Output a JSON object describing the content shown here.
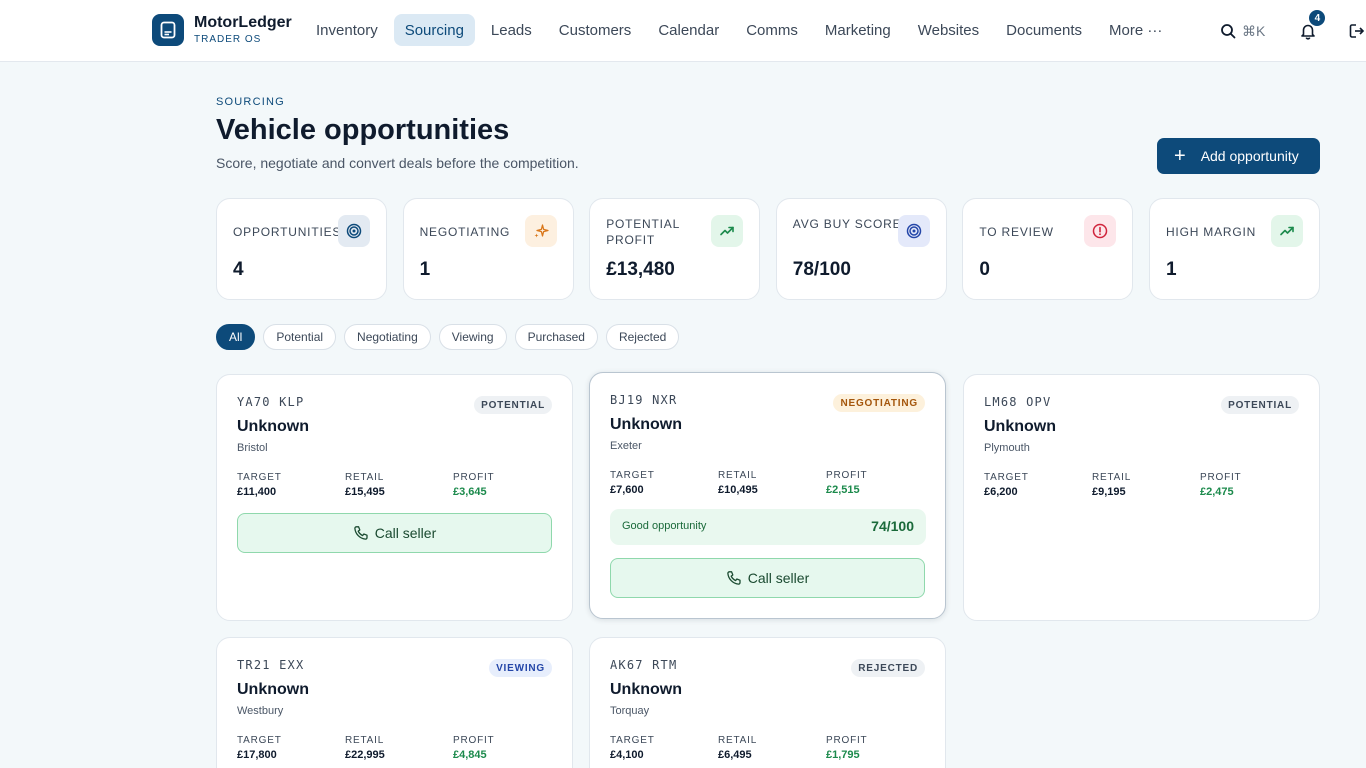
{
  "brand": {
    "name": "MotorLedger",
    "sub": "TRADER OS"
  },
  "nav": {
    "items": [
      {
        "label": "Inventory"
      },
      {
        "label": "Sourcing",
        "active": true
      },
      {
        "label": "Leads"
      },
      {
        "label": "Customers"
      },
      {
        "label": "Calendar"
      },
      {
        "label": "Comms"
      },
      {
        "label": "Marketing"
      },
      {
        "label": "Websites"
      },
      {
        "label": "Documents"
      },
      {
        "label": "More ···"
      }
    ],
    "search_shortcut": "⌘K",
    "notification_count": "4"
  },
  "header": {
    "eyebrow": "SOURCING",
    "title": "Vehicle opportunities",
    "subtitle": "Score, negotiate and convert deals before the competition.",
    "add_button": "Add opportunity"
  },
  "stats": [
    {
      "label": "OPPORTUNITIES",
      "value": "4",
      "icon": "target-icon",
      "icon_bg": "#e3eaf2",
      "icon_color": "#0d4a7a"
    },
    {
      "label": "NEGOTIATING",
      "value": "1",
      "icon": "sparkle-icon",
      "icon_bg": "#fdf0e0",
      "icon_color": "#d9771a"
    },
    {
      "label": "POTENTIAL PROFIT",
      "value": "£13,480",
      "icon": "trending-up-icon",
      "icon_bg": "#e3f6ea",
      "icon_color": "#1c8a4c"
    },
    {
      "label": "AVG BUY SCORE",
      "value": "78/100",
      "icon": "target-icon",
      "icon_bg": "#e4e9fa",
      "icon_color": "#2446a8"
    },
    {
      "label": "TO REVIEW",
      "value": "0",
      "icon": "alert-circle-icon",
      "icon_bg": "#fde6ea",
      "icon_color": "#d0243c"
    },
    {
      "label": "HIGH MARGIN",
      "value": "1",
      "icon": "trending-up-icon",
      "icon_bg": "#e3f6ea",
      "icon_color": "#1c8a4c"
    }
  ],
  "filters": [
    {
      "label": "All",
      "active": true
    },
    {
      "label": "Potential"
    },
    {
      "label": "Negotiating"
    },
    {
      "label": "Viewing"
    },
    {
      "label": "Purchased"
    },
    {
      "label": "Rejected"
    }
  ],
  "metric_labels": {
    "target": "TARGET",
    "retail": "RETAIL",
    "profit": "PROFIT"
  },
  "call_label": "Call seller",
  "opportunities": [
    {
      "plate": "YA70 KLP",
      "status": "POTENTIAL",
      "model": "Unknown",
      "location": "Bristol",
      "target": "£11,400",
      "retail": "£15,495",
      "profit": "£3,645"
    },
    {
      "plate": "BJ19 NXR",
      "status": "NEGOTIATING",
      "model": "Unknown",
      "location": "Exeter",
      "target": "£7,600",
      "retail": "£10,495",
      "profit": "£2,515",
      "score_label": "Good opportunity",
      "score": "74/100"
    },
    {
      "plate": "LM68 OPV",
      "status": "POTENTIAL",
      "model": "Unknown",
      "location": "Plymouth",
      "target": "£6,200",
      "retail": "£9,195",
      "profit": "£2,475"
    },
    {
      "plate": "TR21 EXX",
      "status": "VIEWING",
      "model": "Unknown",
      "location": "Westbury",
      "target": "£17,800",
      "retail": "£22,995",
      "profit": "£4,845"
    },
    {
      "plate": "AK67 RTM",
      "status": "REJECTED",
      "model": "Unknown",
      "location": "Torquay",
      "target": "£4,100",
      "retail": "£6,495",
      "profit": "£1,795"
    }
  ]
}
